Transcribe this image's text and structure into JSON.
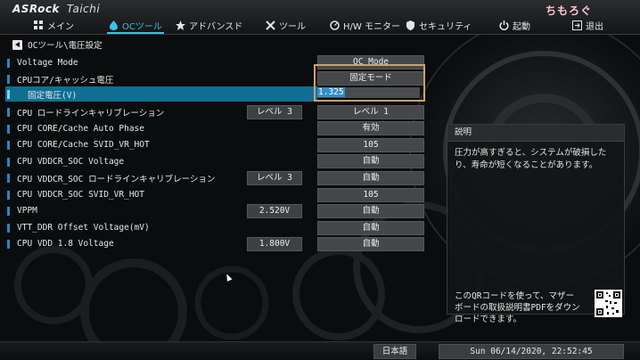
{
  "brand": {
    "name": "ASRock",
    "model": "Taichi"
  },
  "watermark": "ちもろぐ",
  "nav": [
    {
      "label": "メイン",
      "icon": "grid-icon",
      "active": false
    },
    {
      "label": "OCツール",
      "icon": "flame-icon",
      "active": true
    },
    {
      "label": "アドバンスド",
      "icon": "star-icon",
      "active": false
    },
    {
      "label": "ツール",
      "icon": "tools-icon",
      "active": false
    },
    {
      "label": "H/W モニター",
      "icon": "monitor-icon",
      "active": false
    },
    {
      "label": "セキュリティ",
      "icon": "shield-icon",
      "active": false
    },
    {
      "label": "起動",
      "icon": "power-icon",
      "active": false
    },
    {
      "label": "退出",
      "icon": "exit-icon",
      "active": false
    }
  ],
  "breadcrumb": "OCツール\\電圧設定",
  "rows": [
    {
      "label": "Voltage Mode",
      "current": "",
      "value": "OC Mode"
    },
    {
      "label": "CPUコア/キャッシュ電圧",
      "current": "",
      "value": "固定モード"
    },
    {
      "label": "固定電圧(V)",
      "current": "",
      "value": "1.325"
    },
    {
      "label": "CPU ロードラインキャリブレーション",
      "current": "レベル 3",
      "value": "レベル 1"
    },
    {
      "label": "CPU CORE/Cache Auto Phase",
      "current": "",
      "value": "有効"
    },
    {
      "label": "CPU CORE/Cache SVID_VR_HOT",
      "current": "",
      "value": "105"
    },
    {
      "label": "CPU VDDCR_SOC Voltage",
      "current": "",
      "value": "自動"
    },
    {
      "label": "CPU VDDCR_SOC ロードラインキャリブレーション",
      "current": "レベル 3",
      "value": "自動"
    },
    {
      "label": "CPU VDDCR_SOC SVID_VR_HOT",
      "current": "",
      "value": "105"
    },
    {
      "label": "VPPM",
      "current": "2.520V",
      "value": "自動"
    },
    {
      "label": "VTT_DDR Offset Voltage(mV)",
      "current": "",
      "value": "自動"
    },
    {
      "label": "CPU VDD 1.8 Voltage",
      "current": "1.800V",
      "value": "自動"
    }
  ],
  "info": {
    "title": "説明",
    "body": "圧力が高すぎると、システムが破損したり、寿命が短くなることがあります。",
    "qr_text": "このQRコードを使って、マザーボードの取扱説明書PDFをダウンロードできます。"
  },
  "footer": {
    "language": "日本語",
    "datetime": "Sun 06/14/2020, 22:52:45"
  }
}
